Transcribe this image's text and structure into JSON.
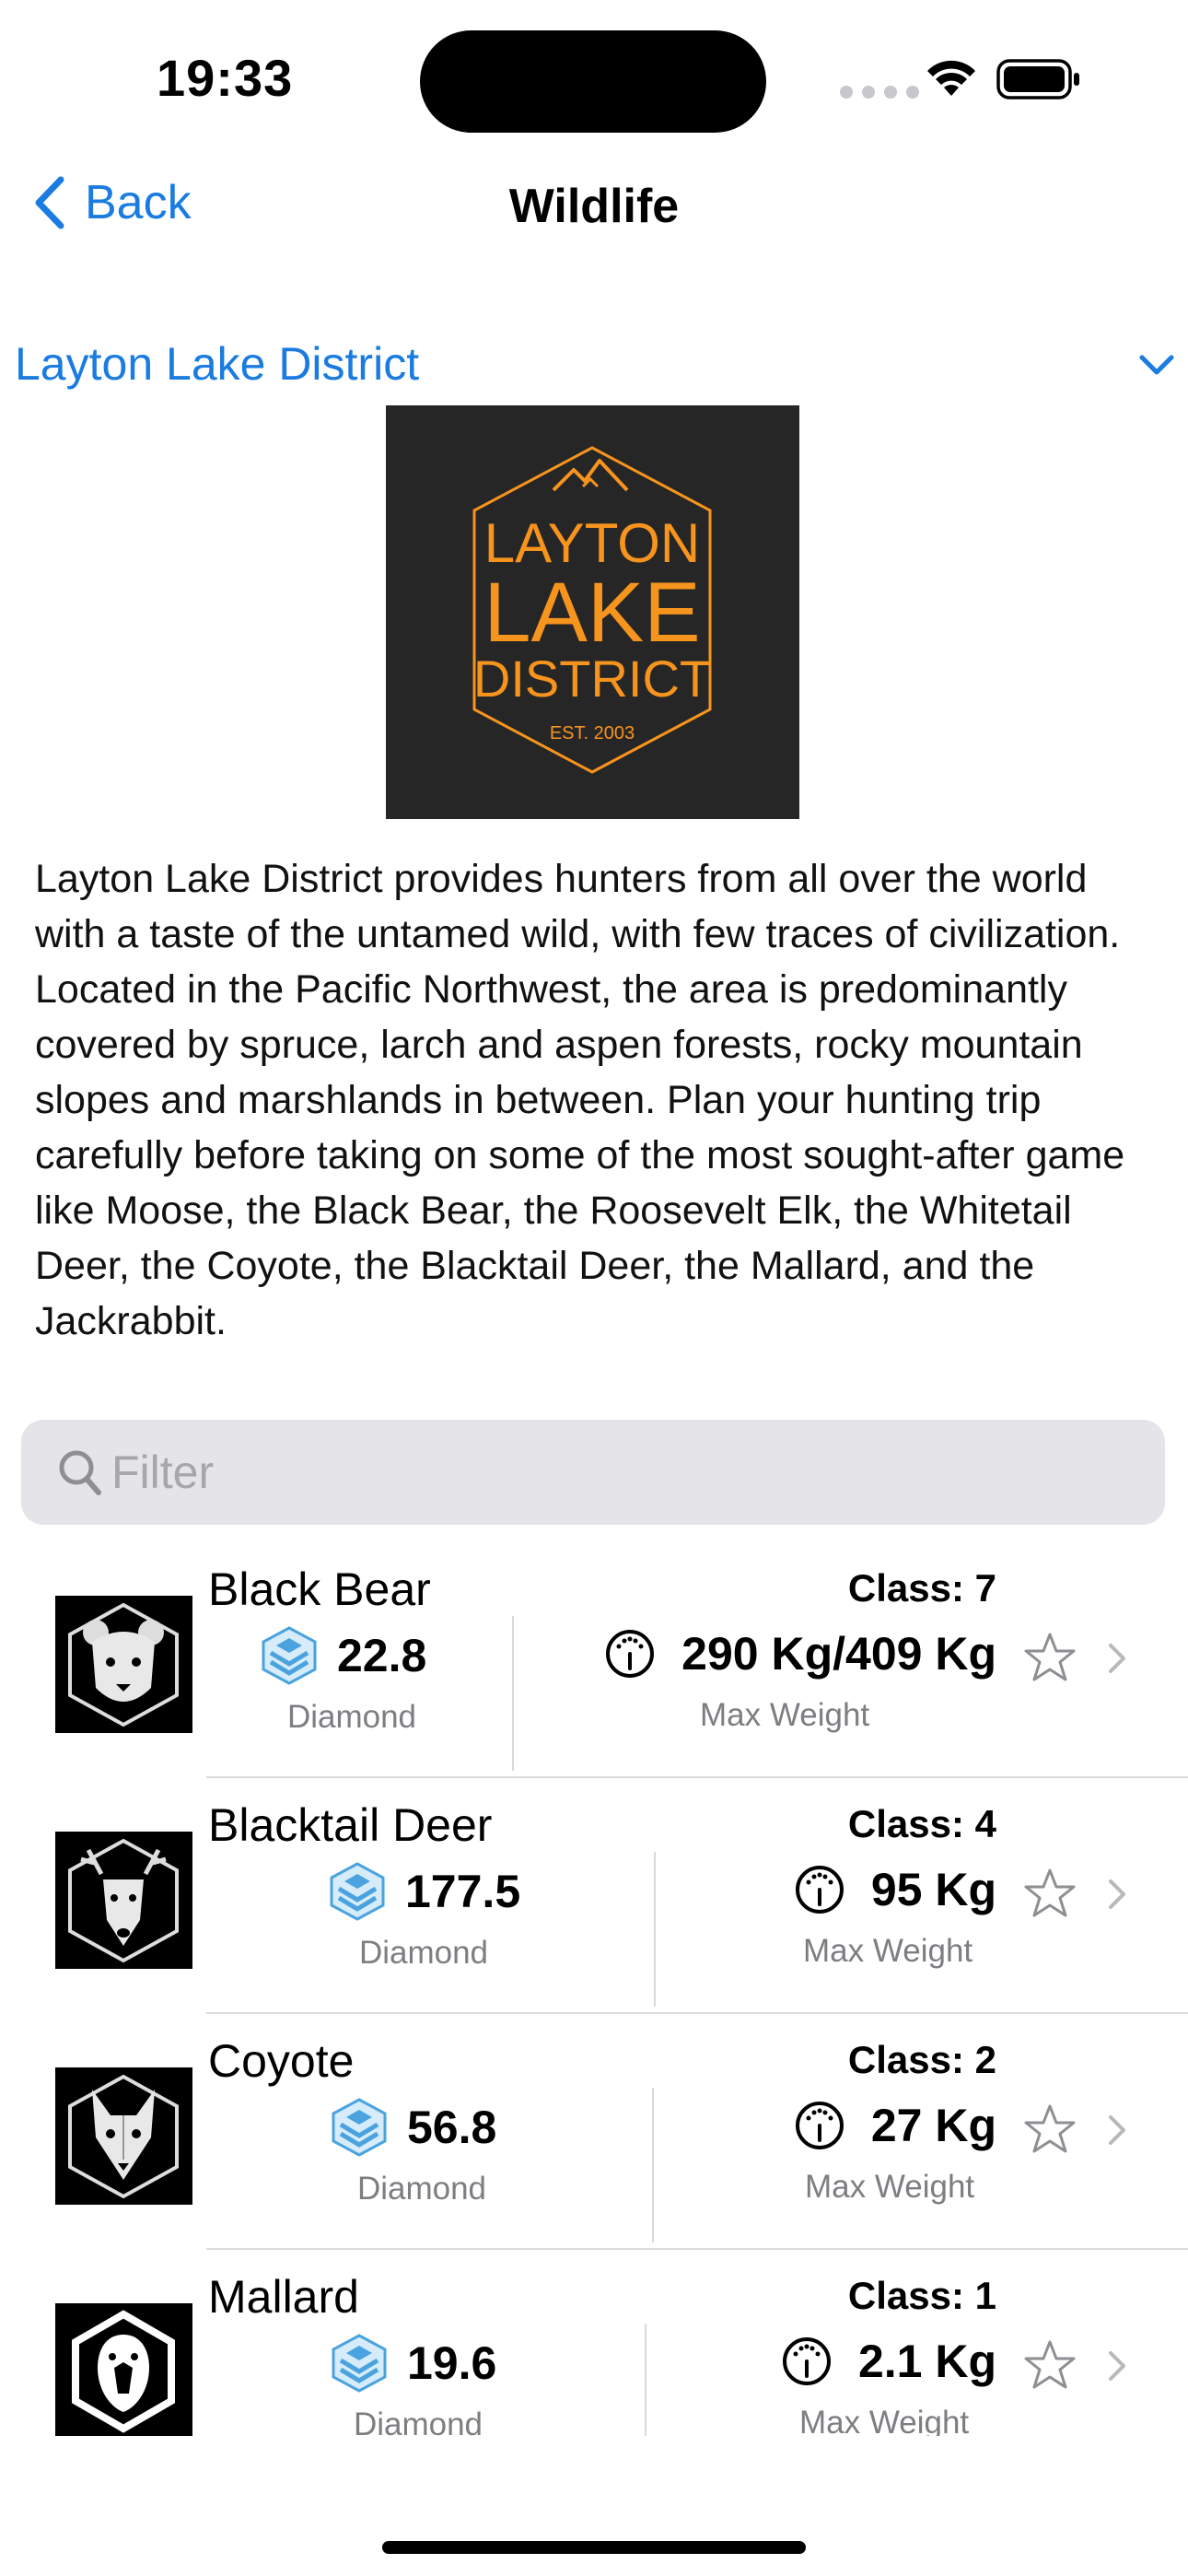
{
  "status_bar": {
    "time": "19:33"
  },
  "nav": {
    "back_label": "Back",
    "title": "Wildlife"
  },
  "region": {
    "name": "Layton Lake District"
  },
  "logo": {
    "line1": "LAYTON",
    "line2": "LAKE",
    "line3": "DISTRICT",
    "est": "EST. 2003",
    "color": "#f7941d",
    "background": "#262626"
  },
  "description": "Layton Lake District provides hunters from all over the world with a taste of the untamed wild, with few traces of civilization. Located in the Pacific Northwest, the area is predominantly covered by spruce, larch and aspen forests, rocky mountain slopes and marshlands in between. Plan your hunting trip carefully before taking on some of the most sought-after game like Moose, the Black Bear, the Roosevelt Elk, the Whitetail Deer, the Coyote, the Blacktail Deer, the Mallard, and the Jackrabbit.",
  "filter": {
    "placeholder": "Filter"
  },
  "animals": [
    {
      "name": "Black Bear",
      "class": "Class: 7",
      "diamond": "22.8",
      "diamond_label": "Diamond",
      "weight": "290 Kg/409 Kg",
      "weight_label": "Max Weight",
      "icon": "bear-icon"
    },
    {
      "name": "Blacktail Deer",
      "class": "Class: 4",
      "diamond": "177.5",
      "diamond_label": "Diamond",
      "weight": "95 Kg",
      "weight_label": "Max Weight",
      "icon": "deer-icon"
    },
    {
      "name": "Coyote",
      "class": "Class: 2",
      "diamond": "56.8",
      "diamond_label": "Diamond",
      "weight": "27 Kg",
      "weight_label": "Max Weight",
      "icon": "coyote-icon"
    },
    {
      "name": "Mallard",
      "class": "Class: 1",
      "diamond": "19.6",
      "diamond_label": "Diamond",
      "weight": "2.1 Kg",
      "weight_label": "Max Weight",
      "icon": "mallard-icon"
    }
  ],
  "colors": {
    "accent": "#1a7be0",
    "diamond_blue": "#4aa3df",
    "secondary_text": "#7d7d82"
  }
}
